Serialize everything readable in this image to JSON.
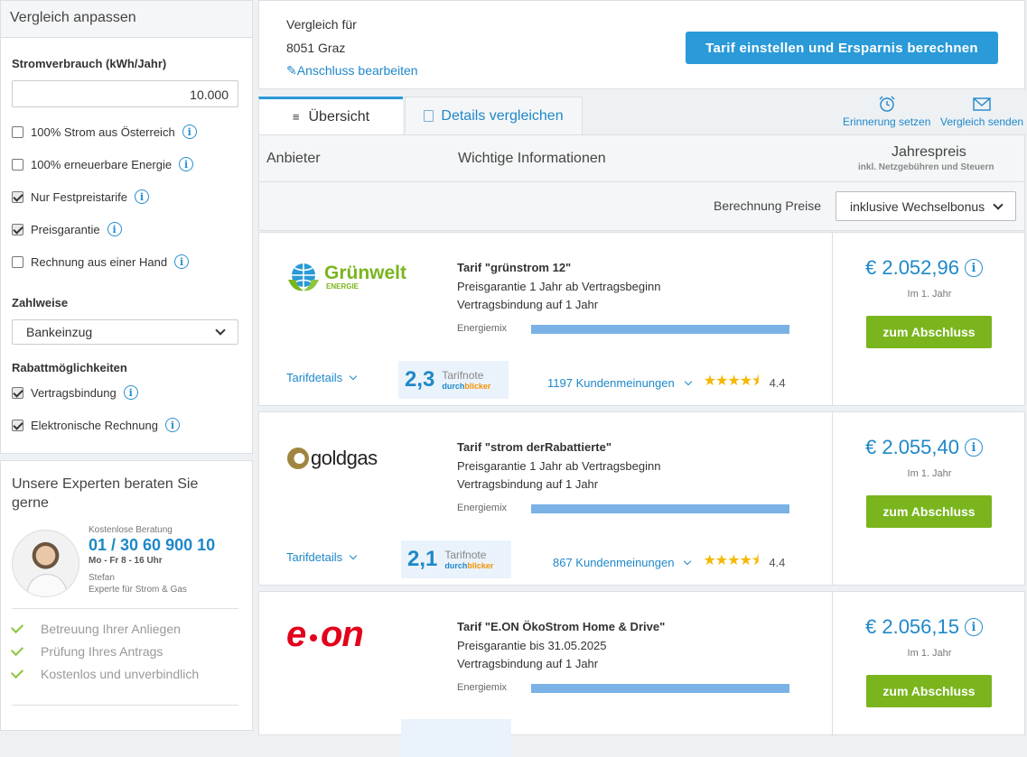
{
  "sidebar": {
    "filter_title": "Vergleich anpassen",
    "consumption_label": "Stromverbrauch (kWh/Jahr)",
    "consumption_value": "10.000",
    "options": [
      {
        "label": "100% Strom aus Österreich",
        "checked": false
      },
      {
        "label": "100% erneuerbare Energie",
        "checked": false
      },
      {
        "label": "Nur Festpreistarife",
        "checked": true
      },
      {
        "label": "Preisgarantie",
        "checked": true
      },
      {
        "label": "Rechnung aus einer Hand",
        "checked": false
      }
    ],
    "payment_label": "Zahlweise",
    "payment_value": "Bankeinzug",
    "discount_label": "Rabattmöglichkeiten",
    "discounts": [
      {
        "label": "Vertragsbindung",
        "checked": true
      },
      {
        "label": "Elektronische Rechnung",
        "checked": true
      }
    ],
    "expert": {
      "title": "Unsere Experten beraten Sie gerne",
      "free_label": "Kostenlose Beratung",
      "phone": "01 / 30 60 900 10",
      "hours": "Mo - Fr 8 - 16 Uhr",
      "name": "Stefan",
      "role": "Experte für Strom & Gas",
      "benefits": [
        "Betreuung Ihrer Anliegen",
        "Prüfung Ihres Antrags",
        "Kostenlos und unverbindlich"
      ]
    }
  },
  "header": {
    "compare_for": "Vergleich für",
    "location": "8051 Graz",
    "edit_link": "Anschluss bearbeiten",
    "cta": "Tarif einstellen und Ersparnis berechnen"
  },
  "tabs": {
    "overview": "Übersicht",
    "details": "Details vergleichen",
    "reminder": "Erinnerung setzen",
    "send": "Vergleich senden"
  },
  "table": {
    "col_provider": "Anbieter",
    "col_info": "Wichtige Informationen",
    "col_price": "Jahrespreis",
    "col_price_sub": "inkl. Netzgebühren und Steuern",
    "calc_label": "Berechnung Preise",
    "calc_value": "inklusive Wechselbonus"
  },
  "offers": [
    {
      "provider": "Grünwelt",
      "provider_sub": "ENERGIE",
      "tarif": "Tarif \"grünstrom 12\"",
      "guarantee": "Preisgarantie 1 Jahr ab Vertragsbeginn",
      "binding": "Vertragsbindung auf 1 Jahr",
      "mix_label": "Energiemix",
      "details_link": "Tarifdetails",
      "note_value": "2,3",
      "note_label": "Tarifnote",
      "reviews": "1197 Kundenmeinungen",
      "rating": "4.4",
      "price": "€ 2.052,96",
      "price_sub": "Im 1. Jahr",
      "button": "zum Abschluss"
    },
    {
      "provider": "goldgas",
      "tarif": "Tarif \"strom derRabattierte\"",
      "guarantee": "Preisgarantie 1 Jahr ab Vertragsbeginn",
      "binding": "Vertragsbindung auf 1 Jahr",
      "mix_label": "Energiemix",
      "details_link": "Tarifdetails",
      "note_value": "2,1",
      "note_label": "Tarifnote",
      "reviews": "867 Kundenmeinungen",
      "rating": "4.4",
      "price": "€ 2.055,40",
      "price_sub": "Im 1. Jahr",
      "button": "zum Abschluss"
    },
    {
      "provider": "e-on",
      "tarif": "Tarif \"E.ON ÖkoStrom Home & Drive\"",
      "guarantee": "Preisgarantie bis 31.05.2025",
      "binding": "Vertragsbindung auf 1 Jahr",
      "mix_label": "Energiemix",
      "price": "€ 2.056,15",
      "price_sub": "Im 1. Jahr",
      "button": "zum Abschluss"
    }
  ],
  "brand": {
    "durch": "durch",
    "blicker": "blicker"
  },
  "colors": {
    "accent": "#2a9ad8",
    "link": "#1e88c9",
    "cta_green": "#7ab51d",
    "mix_bar": "#7ab2e6"
  }
}
